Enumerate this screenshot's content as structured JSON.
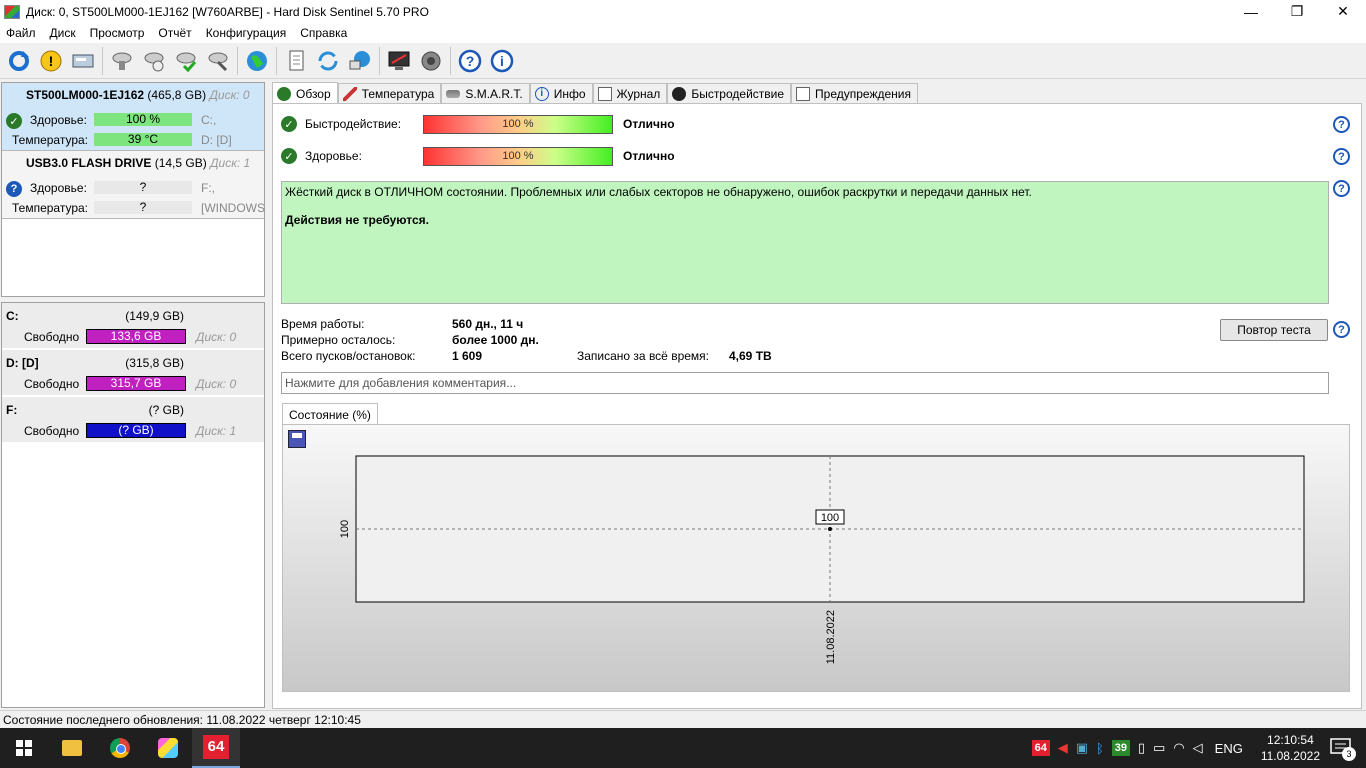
{
  "window": {
    "title": "Диск: 0, ST500LM000-1EJ162 [W760ARBE]  -  Hard Disk Sentinel 5.70 PRO",
    "minimize": "—",
    "maximize": "❐",
    "close": "✕"
  },
  "menu": [
    "Файл",
    "Диск",
    "Просмотр",
    "Отчёт",
    "Конфигурация",
    "Справка"
  ],
  "disks": [
    {
      "name": "ST500LM000-1EJ162",
      "size": "(465,8 GB)",
      "disk_label": "Диск: 0",
      "health_label": "Здоровье:",
      "health_value": "100 %",
      "health_extra": "C:,",
      "temp_label": "Температура:",
      "temp_value": "39 °C",
      "temp_extra": "D: [D]"
    },
    {
      "name": "USB3.0  FLASH DRIVE",
      "size": "(14,5 GB)",
      "disk_label": "Диск: 1",
      "health_label": "Здоровье:",
      "health_value": "?",
      "health_extra": "F:,",
      "temp_label": "Температура:",
      "temp_value": "?",
      "temp_extra": "[WINDOWS"
    }
  ],
  "volumes": [
    {
      "name": "C:",
      "size": "(149,9 GB)",
      "free_label": "Свободно",
      "free": "133,6 GB",
      "disk": "Диск: 0",
      "color": "#c020c0"
    },
    {
      "name": "D: [D]",
      "size": "(315,8 GB)",
      "free_label": "Свободно",
      "free": "315,7 GB",
      "disk": "Диск: 0",
      "color": "#c020c0"
    },
    {
      "name": "F:",
      "size": "(? GB)",
      "free_label": "Свободно",
      "free": "(? GB)",
      "disk": "Диск: 1",
      "color": "#1010c8"
    }
  ],
  "tabs": [
    "Обзор",
    "Температура",
    "S.M.A.R.T.",
    "Инфо",
    "Журнал",
    "Быстродействие",
    "Предупреждения"
  ],
  "overview": {
    "performance_label": "Быстродействие:",
    "performance_value": "100 %",
    "performance_status": "Отлично",
    "health_label": "Здоровье:",
    "health_value": "100 %",
    "health_status": "Отлично",
    "message_line1": "Жёсткий диск в ОТЛИЧНОМ состоянии. Проблемных или слабых секторов не обнаружено, ошибок раскрутки и передачи данных нет.",
    "message_line2": "Действия не требуются.",
    "uptime_label": "Время работы:",
    "uptime_value": "560 дн., 11 ч",
    "remaining_label": "Примерно осталось:",
    "remaining_value": "более 1000 дн.",
    "starts_label": "Всего пусков/остановок:",
    "starts_value": "1 609",
    "written_label": "Записано за всё время:",
    "written_value": "4,69 TB",
    "retest_button": "Повтор теста",
    "comment_placeholder": "Нажмите для добавления комментария..."
  },
  "chart_tab": "Состояние (%)",
  "chart_data": {
    "type": "line",
    "title": "",
    "xlabel": "",
    "ylabel": "",
    "x": [
      "11.08.2022"
    ],
    "series": [
      {
        "values": [
          100
        ]
      }
    ],
    "ylim": [
      99,
      101
    ],
    "grid": true,
    "data_labels": [
      "100"
    ],
    "y_ticks": [
      "100"
    ]
  },
  "statusbar": "Состояние последнего обновления: 11.08.2022 четверг 12:10:45",
  "taskbar": {
    "task_64": "64",
    "tray_64": "64",
    "tray_39": "39",
    "lang": "ENG",
    "time": "12:10:54",
    "date": "11.08.2022",
    "notifications": "3"
  },
  "colors": {
    "health_green": "#7ee57e",
    "message_bg": "#c0f5c0",
    "selected_disk_bg": "#cfe6f8"
  }
}
